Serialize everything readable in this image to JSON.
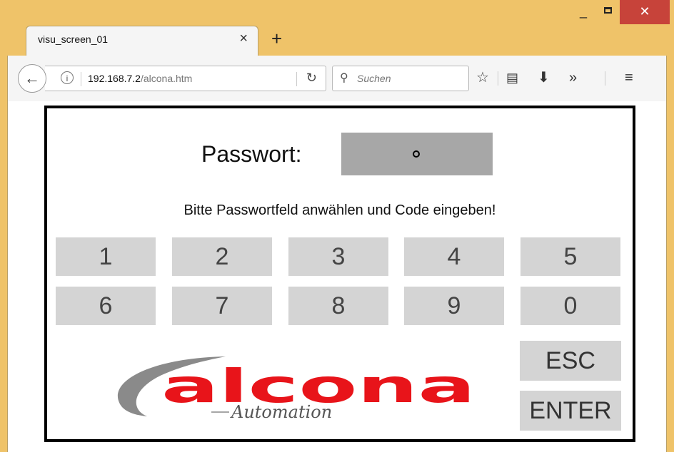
{
  "browser": {
    "tab_title": "visu_screen_01",
    "url_host": "192.168.7.2",
    "url_path": "/alcona.htm",
    "search_placeholder": "Suchen"
  },
  "app": {
    "password_label": "Passwort:",
    "password_masked": "•",
    "hint": "Bitte Passwortfeld anwählen und Code eingeben!",
    "keys_row1": [
      "1",
      "2",
      "3",
      "4",
      "5"
    ],
    "keys_row2": [
      "6",
      "7",
      "8",
      "9",
      "0"
    ],
    "esc_label": "ESC",
    "enter_label": "ENTER",
    "logo_text": "alcona",
    "logo_subtitle": "Automation",
    "colors": {
      "keypad": "#d4d4d4",
      "password_field": "#a7a7a7",
      "logo_red": "#e8141a",
      "logo_gray": "#8a8a8a"
    }
  }
}
